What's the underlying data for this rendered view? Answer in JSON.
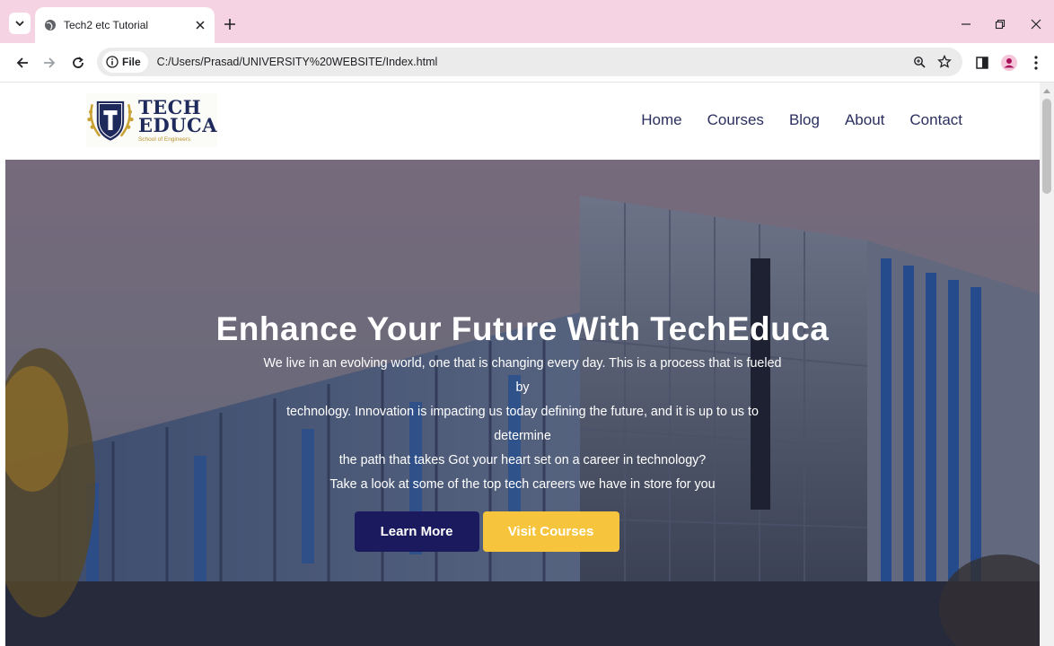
{
  "browser": {
    "tab_title": "Tech2 etc Tutorial",
    "site_chip": "File",
    "url": "C:/Users/Prasad/UNIVERSITY%20WEBSITE/Index.html",
    "accent_color": "#f6d3e2"
  },
  "site": {
    "logo": {
      "line1": "TECH",
      "line2": "EDUCA",
      "tagline": "School of Engineers",
      "badge_letter": "T"
    },
    "nav": [
      {
        "label": "Home"
      },
      {
        "label": "Courses"
      },
      {
        "label": "Blog"
      },
      {
        "label": "About"
      },
      {
        "label": "Contact"
      }
    ]
  },
  "hero": {
    "title": "Enhance Your Future With TechEduca",
    "lines": [
      "We live in an evolving world, one that is changing every day. This is a process that is fueled by",
      "technology. Innovation is impacting us today defining the future, and it is up to us to determine",
      "the path that takes Got your heart set on a career in technology?",
      "Take a look at some of the top tech careers we have in store for you"
    ],
    "primary_button": "Learn More",
    "secondary_button": "Visit Courses",
    "primary_color": "#1c1a5e",
    "secondary_color": "#f7c53d"
  }
}
